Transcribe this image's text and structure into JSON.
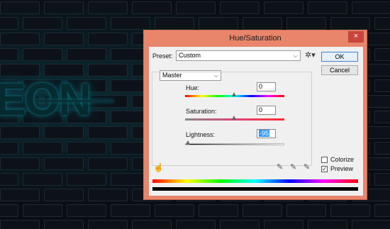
{
  "dialog": {
    "title": "Hue/Saturation",
    "close_label": "×",
    "preset_label": "Preset:",
    "preset_value": "Custom",
    "ok_label": "OK",
    "cancel_label": "Cancel",
    "channel_value": "Master",
    "hue_label": "Hue:",
    "hue_value": "0",
    "saturation_label": "Saturation:",
    "saturation_value": "0",
    "lightness_label": "Lightness:",
    "lightness_value": "-95",
    "colorize_label": "Colorize",
    "colorize_checked": false,
    "preview_label": "Preview",
    "preview_checked": true
  },
  "background": {
    "neon_text": "EON"
  },
  "icons": {
    "gear": "gear-icon",
    "chevron": "chevron-down-icon",
    "hand": "targeted-adjustment-icon",
    "eyedropper": "eyedropper-icon",
    "eyedropper_plus": "eyedropper-plus-icon",
    "eyedropper_minus": "eyedropper-minus-icon"
  },
  "colors": {
    "title_bar": "#e8856a",
    "close_button": "#c9453a",
    "selection": "#3399ff"
  }
}
